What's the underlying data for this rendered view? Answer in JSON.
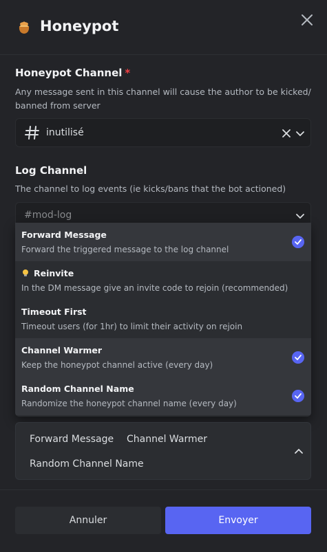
{
  "modal": {
    "title": "Honeypot",
    "logo_icon": "honeypot-icon",
    "close_icon": "close-icon"
  },
  "honeypot_channel": {
    "label": "Honeypot Channel",
    "required_marker": "*",
    "description": "Any message sent in this channel will cause the author to be kicked/ banned from server",
    "value": "inutilisé",
    "icon": "hash-icon"
  },
  "log_channel": {
    "label": "Log Channel",
    "description": "The channel to log events (ie kicks/bans that the bot actioned)",
    "value": "#mod-log"
  },
  "options": [
    {
      "title": "Forward Message",
      "description": "Forward the triggered message to the log channel",
      "selected": true
    },
    {
      "title": "Reinvite",
      "description": "In the DM message give an invite code to rejoin (recommended)",
      "selected": false,
      "icon": "lightbulb-icon"
    },
    {
      "title": "Timeout First",
      "description": "Timeout users (for 1hr) to limit their activity on rejoin",
      "selected": false
    },
    {
      "title": "Channel Warmer",
      "description": "Keep the honeypot channel active (every day)",
      "selected": true
    },
    {
      "title": "Random Channel Name",
      "description": "Randomize the honeypot channel name (every day)",
      "selected": true
    }
  ],
  "selected_chips": [
    "Forward Message",
    "Channel Warmer",
    "Random Channel Name"
  ],
  "footer": {
    "cancel_label": "Annuler",
    "submit_label": "Envoyer"
  },
  "colors": {
    "accent": "#5865f2",
    "background": "#232428",
    "input_bg": "#1e1f22",
    "required": "#f23f43"
  }
}
